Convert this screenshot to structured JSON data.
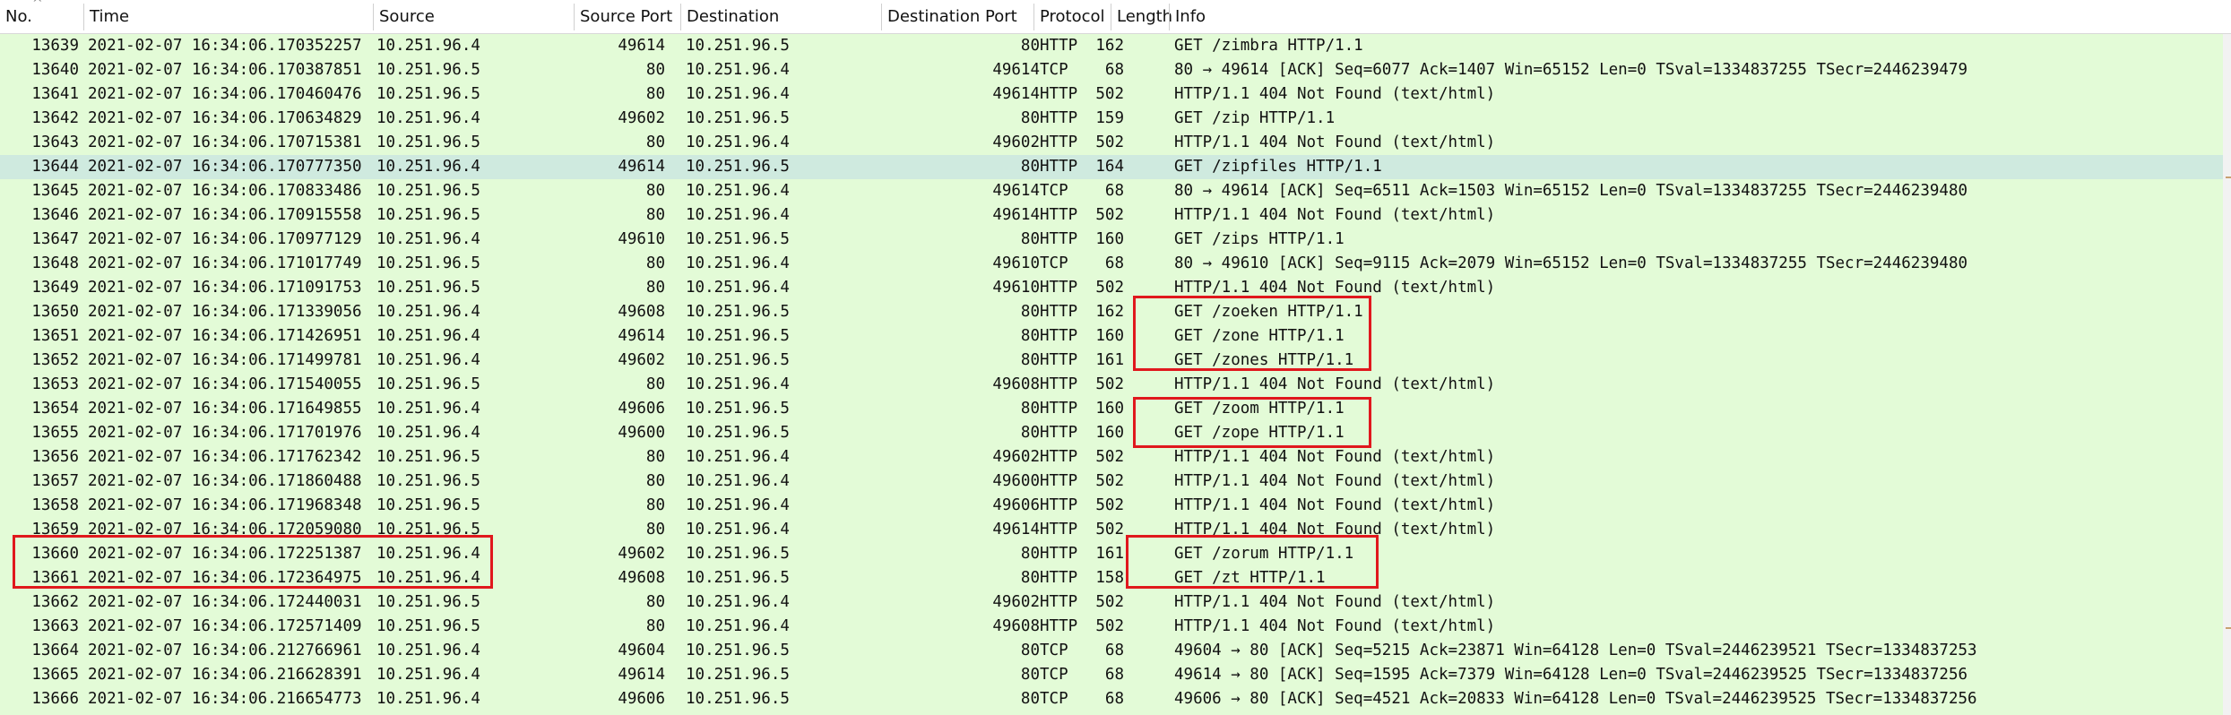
{
  "columns": {
    "no": "No.",
    "time": "Time",
    "source": "Source",
    "source_port": "Source Port",
    "destination": "Destination",
    "destination_port": "Destination Port",
    "protocol": "Protocol",
    "length": "Length",
    "info": "Info"
  },
  "sort_indicator": "^",
  "selected_packet": "13644",
  "colors": {
    "row_bg": "#e3fbd7",
    "selected_bg": "#cfeadf",
    "highlight_box": "#e0181d"
  },
  "rows": [
    {
      "no": "13639",
      "time": "2021-02-07 16:34:06.170352257",
      "src": "10.251.96.4",
      "sport": "49614",
      "dst": "10.251.96.5",
      "dport": "80",
      "proto": "HTTP",
      "len": "162",
      "info": "GET /zimbra HTTP/1.1"
    },
    {
      "no": "13640",
      "time": "2021-02-07 16:34:06.170387851",
      "src": "10.251.96.5",
      "sport": "80",
      "dst": "10.251.96.4",
      "dport": "49614",
      "proto": "TCP",
      "len": "68",
      "info": "80 → 49614 [ACK] Seq=6077 Ack=1407 Win=65152 Len=0 TSval=1334837255 TSecr=2446239479"
    },
    {
      "no": "13641",
      "time": "2021-02-07 16:34:06.170460476",
      "src": "10.251.96.5",
      "sport": "80",
      "dst": "10.251.96.4",
      "dport": "49614",
      "proto": "HTTP",
      "len": "502",
      "info": "HTTP/1.1 404 Not Found  (text/html)"
    },
    {
      "no": "13642",
      "time": "2021-02-07 16:34:06.170634829",
      "src": "10.251.96.4",
      "sport": "49602",
      "dst": "10.251.96.5",
      "dport": "80",
      "proto": "HTTP",
      "len": "159",
      "info": "GET /zip HTTP/1.1"
    },
    {
      "no": "13643",
      "time": "2021-02-07 16:34:06.170715381",
      "src": "10.251.96.5",
      "sport": "80",
      "dst": "10.251.96.4",
      "dport": "49602",
      "proto": "HTTP",
      "len": "502",
      "info": "HTTP/1.1 404 Not Found  (text/html)"
    },
    {
      "no": "13644",
      "time": "2021-02-07 16:34:06.170777350",
      "src": "10.251.96.4",
      "sport": "49614",
      "dst": "10.251.96.5",
      "dport": "80",
      "proto": "HTTP",
      "len": "164",
      "info": "GET /zipfiles HTTP/1.1"
    },
    {
      "no": "13645",
      "time": "2021-02-07 16:34:06.170833486",
      "src": "10.251.96.5",
      "sport": "80",
      "dst": "10.251.96.4",
      "dport": "49614",
      "proto": "TCP",
      "len": "68",
      "info": "80 → 49614 [ACK] Seq=6511 Ack=1503 Win=65152 Len=0 TSval=1334837255 TSecr=2446239480"
    },
    {
      "no": "13646",
      "time": "2021-02-07 16:34:06.170915558",
      "src": "10.251.96.5",
      "sport": "80",
      "dst": "10.251.96.4",
      "dport": "49614",
      "proto": "HTTP",
      "len": "502",
      "info": "HTTP/1.1 404 Not Found  (text/html)"
    },
    {
      "no": "13647",
      "time": "2021-02-07 16:34:06.170977129",
      "src": "10.251.96.4",
      "sport": "49610",
      "dst": "10.251.96.5",
      "dport": "80",
      "proto": "HTTP",
      "len": "160",
      "info": "GET /zips HTTP/1.1"
    },
    {
      "no": "13648",
      "time": "2021-02-07 16:34:06.171017749",
      "src": "10.251.96.5",
      "sport": "80",
      "dst": "10.251.96.4",
      "dport": "49610",
      "proto": "TCP",
      "len": "68",
      "info": "80 → 49610 [ACK] Seq=9115 Ack=2079 Win=65152 Len=0 TSval=1334837255 TSecr=2446239480"
    },
    {
      "no": "13649",
      "time": "2021-02-07 16:34:06.171091753",
      "src": "10.251.96.5",
      "sport": "80",
      "dst": "10.251.96.4",
      "dport": "49610",
      "proto": "HTTP",
      "len": "502",
      "info": "HTTP/1.1 404 Not Found  (text/html)"
    },
    {
      "no": "13650",
      "time": "2021-02-07 16:34:06.171339056",
      "src": "10.251.96.4",
      "sport": "49608",
      "dst": "10.251.96.5",
      "dport": "80",
      "proto": "HTTP",
      "len": "162",
      "info": "GET /zoeken HTTP/1.1"
    },
    {
      "no": "13651",
      "time": "2021-02-07 16:34:06.171426951",
      "src": "10.251.96.4",
      "sport": "49614",
      "dst": "10.251.96.5",
      "dport": "80",
      "proto": "HTTP",
      "len": "160",
      "info": "GET /zone HTTP/1.1"
    },
    {
      "no": "13652",
      "time": "2021-02-07 16:34:06.171499781",
      "src": "10.251.96.4",
      "sport": "49602",
      "dst": "10.251.96.5",
      "dport": "80",
      "proto": "HTTP",
      "len": "161",
      "info": "GET /zones HTTP/1.1"
    },
    {
      "no": "13653",
      "time": "2021-02-07 16:34:06.171540055",
      "src": "10.251.96.5",
      "sport": "80",
      "dst": "10.251.96.4",
      "dport": "49608",
      "proto": "HTTP",
      "len": "502",
      "info": "HTTP/1.1 404 Not Found  (text/html)"
    },
    {
      "no": "13654",
      "time": "2021-02-07 16:34:06.171649855",
      "src": "10.251.96.4",
      "sport": "49606",
      "dst": "10.251.96.5",
      "dport": "80",
      "proto": "HTTP",
      "len": "160",
      "info": "GET /zoom HTTP/1.1"
    },
    {
      "no": "13655",
      "time": "2021-02-07 16:34:06.171701976",
      "src": "10.251.96.4",
      "sport": "49600",
      "dst": "10.251.96.5",
      "dport": "80",
      "proto": "HTTP",
      "len": "160",
      "info": "GET /zope HTTP/1.1"
    },
    {
      "no": "13656",
      "time": "2021-02-07 16:34:06.171762342",
      "src": "10.251.96.5",
      "sport": "80",
      "dst": "10.251.96.4",
      "dport": "49602",
      "proto": "HTTP",
      "len": "502",
      "info": "HTTP/1.1 404 Not Found  (text/html)"
    },
    {
      "no": "13657",
      "time": "2021-02-07 16:34:06.171860488",
      "src": "10.251.96.5",
      "sport": "80",
      "dst": "10.251.96.4",
      "dport": "49600",
      "proto": "HTTP",
      "len": "502",
      "info": "HTTP/1.1 404 Not Found  (text/html)"
    },
    {
      "no": "13658",
      "time": "2021-02-07 16:34:06.171968348",
      "src": "10.251.96.5",
      "sport": "80",
      "dst": "10.251.96.4",
      "dport": "49606",
      "proto": "HTTP",
      "len": "502",
      "info": "HTTP/1.1 404 Not Found  (text/html)"
    },
    {
      "no": "13659",
      "time": "2021-02-07 16:34:06.172059080",
      "src": "10.251.96.5",
      "sport": "80",
      "dst": "10.251.96.4",
      "dport": "49614",
      "proto": "HTTP",
      "len": "502",
      "info": "HTTP/1.1 404 Not Found  (text/html)"
    },
    {
      "no": "13660",
      "time": "2021-02-07 16:34:06.172251387",
      "src": "10.251.96.4",
      "sport": "49602",
      "dst": "10.251.96.5",
      "dport": "80",
      "proto": "HTTP",
      "len": "161",
      "info": "GET /zorum HTTP/1.1"
    },
    {
      "no": "13661",
      "time": "2021-02-07 16:34:06.172364975",
      "src": "10.251.96.4",
      "sport": "49608",
      "dst": "10.251.96.5",
      "dport": "80",
      "proto": "HTTP",
      "len": "158",
      "info": "GET /zt HTTP/1.1"
    },
    {
      "no": "13662",
      "time": "2021-02-07 16:34:06.172440031",
      "src": "10.251.96.5",
      "sport": "80",
      "dst": "10.251.96.4",
      "dport": "49602",
      "proto": "HTTP",
      "len": "502",
      "info": "HTTP/1.1 404 Not Found  (text/html)"
    },
    {
      "no": "13663",
      "time": "2021-02-07 16:34:06.172571409",
      "src": "10.251.96.5",
      "sport": "80",
      "dst": "10.251.96.4",
      "dport": "49608",
      "proto": "HTTP",
      "len": "502",
      "info": "HTTP/1.1 404 Not Found  (text/html)"
    },
    {
      "no": "13664",
      "time": "2021-02-07 16:34:06.212766961",
      "src": "10.251.96.4",
      "sport": "49604",
      "dst": "10.251.96.5",
      "dport": "80",
      "proto": "TCP",
      "len": "68",
      "info": "49604 → 80 [ACK] Seq=5215 Ack=23871 Win=64128 Len=0 TSval=2446239521 TSecr=1334837253"
    },
    {
      "no": "13665",
      "time": "2021-02-07 16:34:06.216628391",
      "src": "10.251.96.4",
      "sport": "49614",
      "dst": "10.251.96.5",
      "dport": "80",
      "proto": "TCP",
      "len": "68",
      "info": "49614 → 80 [ACK] Seq=1595 Ack=7379 Win=64128 Len=0 TSval=2446239525 TSecr=1334837256"
    },
    {
      "no": "13666",
      "time": "2021-02-07 16:34:06.216654773",
      "src": "10.251.96.4",
      "sport": "49606",
      "dst": "10.251.96.5",
      "dport": "80",
      "proto": "TCP",
      "len": "68",
      "info": "49606 → 80 [ACK] Seq=4521 Ack=20833 Win=64128 Len=0 TSval=2446239525 TSecr=1334837256"
    }
  ]
}
